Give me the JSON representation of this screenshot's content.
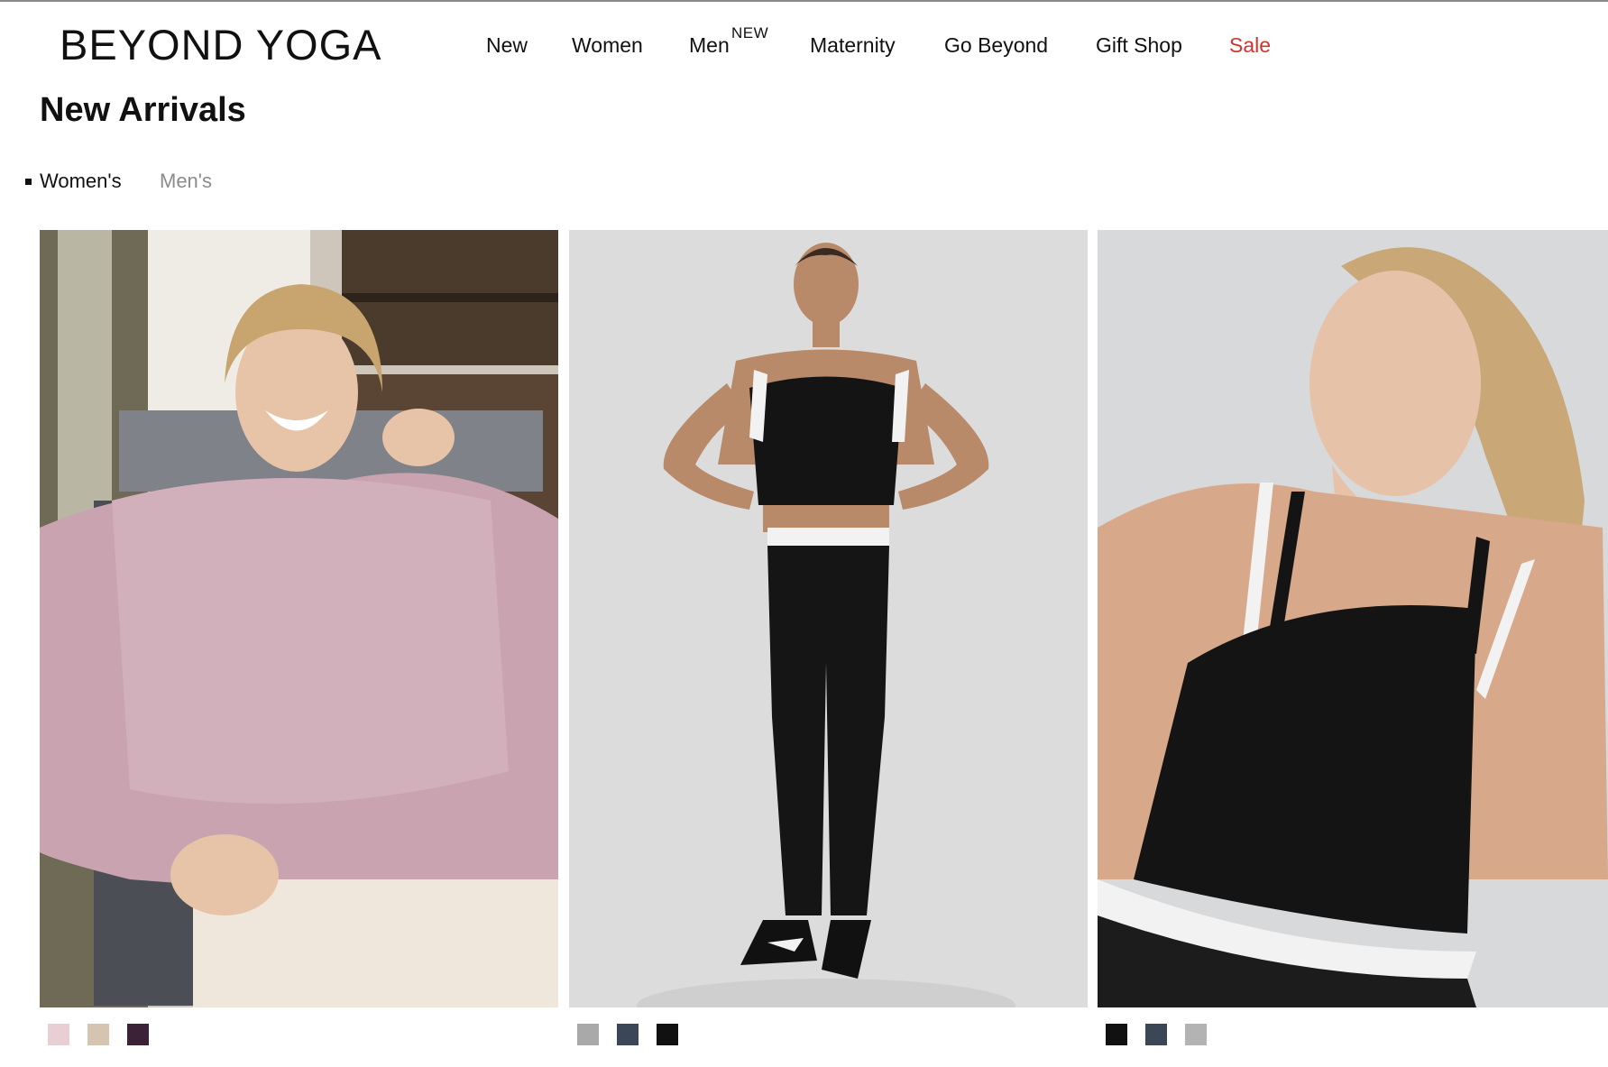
{
  "brand": {
    "logo_text": "BEYOND YOGA"
  },
  "nav": {
    "items": [
      {
        "label": "New"
      },
      {
        "label": "Women"
      },
      {
        "label": "Men",
        "badge": "NEW"
      },
      {
        "label": "Maternity"
      },
      {
        "label": "Go Beyond"
      },
      {
        "label": "Gift Shop"
      },
      {
        "label": "Sale"
      }
    ]
  },
  "page": {
    "title": "New Arrivals"
  },
  "tabs": [
    {
      "label": "Women's",
      "active": true
    },
    {
      "label": "Men's",
      "active": false
    }
  ],
  "products": [
    {
      "image": "woman-laughing-pink-sherpa-half-zip",
      "swatches": [
        "#e8cfd3",
        "#d4c4b0",
        "#3c2236"
      ]
    },
    {
      "image": "woman-black-sports-bra-black-leggings",
      "swatches": [
        "#a9a9a9",
        "#3b4757",
        "#111111"
      ]
    },
    {
      "image": "woman-black-crop-bra-closeup",
      "swatches": [
        "#111111",
        "#3b4757",
        "#b3b3b3"
      ]
    }
  ]
}
